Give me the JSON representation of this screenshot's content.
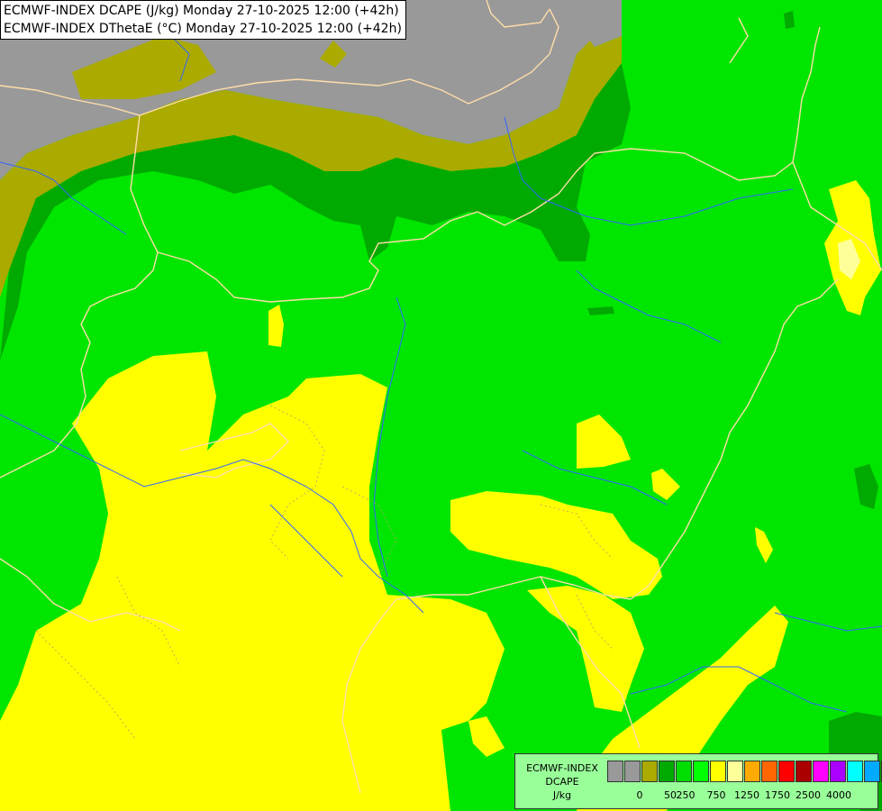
{
  "title": {
    "line1": "ECMWF-INDEX DCAPE (J/kg) Monday 27-10-2025 12:00 (+42h)",
    "line2": "ECMWF-INDEX DThetaE (°C) Monday 27-10-2025 12:00 (+42h)"
  },
  "legend": {
    "title1": "ECMWF-INDEX",
    "title2": "DCAPE",
    "unit": "J/kg",
    "colors": [
      "#999999",
      "#999999",
      "#aaaa00",
      "#00aa00",
      "#00dd00",
      "#00ff00",
      "#ffff00",
      "#ffff99",
      "#ffaa00",
      "#ff6600",
      "#ff0000",
      "#aa0000",
      "#ff00ff",
      "#aa00ff",
      "#00ffff",
      "#00aaff",
      "#0000ff",
      "#000099"
    ],
    "ticks": [
      "0",
      "50",
      "250",
      "750",
      "1250",
      "1750",
      "2500",
      "4000"
    ]
  },
  "colors": {
    "no_data": "#999999",
    "low": "#aaaa00",
    "dark_green": "#00aa00",
    "green": "#00e600",
    "yellow": "#ffff00",
    "light_yellow": "#ffff99",
    "border_line": "#ffddaa",
    "river_line": "#3366ff"
  }
}
